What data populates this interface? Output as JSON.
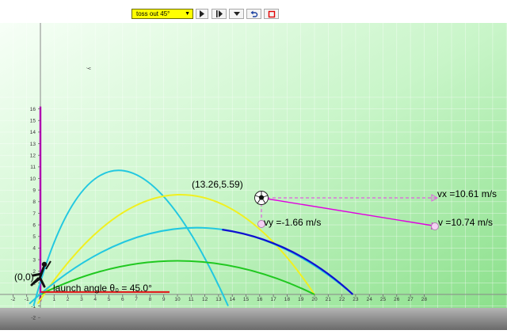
{
  "toolbar": {
    "scenario": "toss out 45°",
    "buttons": [
      {
        "name": "play-button",
        "icon": "play-icon"
      },
      {
        "name": "step-button",
        "icon": "step-forward-icon"
      },
      {
        "name": "menu-button",
        "icon": "dropdown-icon"
      },
      {
        "name": "reset-button",
        "icon": "undo-icon"
      },
      {
        "name": "stop-button",
        "icon": "stop-icon"
      }
    ]
  },
  "graph": {
    "x_ticks": [
      "-2",
      "-1",
      "0",
      "1",
      "2",
      "3",
      "4",
      "5",
      "6",
      "7",
      "8",
      "9",
      "10",
      "11",
      "12",
      "13",
      "14",
      "15",
      "16",
      "17",
      "18",
      "19",
      "20",
      "21",
      "22",
      "23",
      "24",
      "25",
      "26",
      "27",
      "28"
    ],
    "y_ticks": [
      "-2",
      "-1",
      "1",
      "2",
      "3",
      "4",
      "5",
      "6",
      "7",
      "8",
      "9",
      "10",
      "11",
      "12",
      "13",
      "14",
      "15",
      "16"
    ],
    "y_axis_label": "y",
    "origin_label": "(0,0)",
    "launch_angle_label": "launch angle θ₀ = 45.0°",
    "ball_position_label": "(13.26,5.59)",
    "vx_label": "vx =10.61 m/s",
    "vy_label": "vy =-1.66 m/s",
    "v_label": "v =10.74 m/s"
  },
  "colors": {
    "background_top": "#f4fff4",
    "background_bottom": "#8fe28f",
    "ground": "#8a8a8a",
    "trajectory_cyan": "#22c8e0",
    "trajectory_yellow": "#f0f020",
    "trajectory_green": "#20c820",
    "trajectory_blue": "#1010d0",
    "velocity_vector": "#e040e0",
    "angle_arc": "#e02020",
    "y_axis": "#b000b0"
  }
}
